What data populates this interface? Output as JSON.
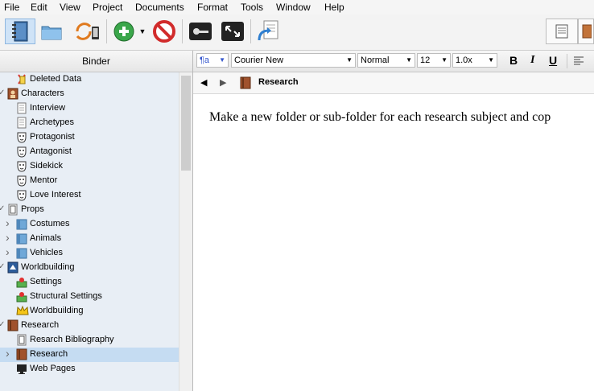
{
  "menu": [
    "File",
    "Edit",
    "View",
    "Project",
    "Documents",
    "Format",
    "Tools",
    "Window",
    "Help"
  ],
  "binder": {
    "header": "Binder",
    "items": [
      {
        "label": "Deleted Data",
        "icon": "deleted-data-icon",
        "indent": 1,
        "chevron": ""
      },
      {
        "label": "Characters",
        "icon": "characters-folder-icon",
        "indent": 0,
        "chevron": "expanded"
      },
      {
        "label": "Interview",
        "icon": "document-icon",
        "indent": 1,
        "chevron": ""
      },
      {
        "label": "Archetypes",
        "icon": "document-icon",
        "indent": 1,
        "chevron": ""
      },
      {
        "label": "Protagonist",
        "icon": "mask-icon",
        "indent": 1,
        "chevron": ""
      },
      {
        "label": "Antagonist",
        "icon": "mask-icon",
        "indent": 1,
        "chevron": ""
      },
      {
        "label": "Sidekick",
        "icon": "mask-icon",
        "indent": 1,
        "chevron": ""
      },
      {
        "label": "Mentor",
        "icon": "mask-icon",
        "indent": 1,
        "chevron": ""
      },
      {
        "label": "Love Interest",
        "icon": "mask-icon",
        "indent": 1,
        "chevron": ""
      },
      {
        "label": "Props",
        "icon": "props-icon",
        "indent": 0,
        "chevron": "expanded"
      },
      {
        "label": "Costumes",
        "icon": "folder-icon",
        "indent": 1,
        "chevron": "collapsed"
      },
      {
        "label": "Animals",
        "icon": "folder-icon",
        "indent": 1,
        "chevron": "collapsed"
      },
      {
        "label": "Vehicles",
        "icon": "folder-icon",
        "indent": 1,
        "chevron": "collapsed"
      },
      {
        "label": "Worldbuilding",
        "icon": "worldbuilding-icon",
        "indent": 0,
        "chevron": "expanded"
      },
      {
        "label": "Settings",
        "icon": "settings-icon",
        "indent": 1,
        "chevron": ""
      },
      {
        "label": "Structural Settings",
        "icon": "settings-icon",
        "indent": 1,
        "chevron": ""
      },
      {
        "label": "Worldbuilding",
        "icon": "crown-icon",
        "indent": 1,
        "chevron": ""
      },
      {
        "label": "Research",
        "icon": "book-icon",
        "indent": 0,
        "chevron": "expanded"
      },
      {
        "label": "Resarch Bibliography",
        "icon": "props-icon",
        "indent": 1,
        "chevron": ""
      },
      {
        "label": "Research",
        "icon": "book-icon",
        "indent": 1,
        "chevron": "collapsed",
        "selected": true
      },
      {
        "label": "Web Pages",
        "icon": "monitor-icon",
        "indent": 1,
        "chevron": ""
      }
    ]
  },
  "format": {
    "style_icon": "¶a",
    "font": "Courier New",
    "style": "Normal",
    "size": "12",
    "spacing": "1.0x",
    "bold": "B",
    "italic": "I",
    "underline": "U"
  },
  "nav": {
    "title": "Research"
  },
  "editor": {
    "text": "Make a new folder or sub-folder for each research subject and cop"
  }
}
